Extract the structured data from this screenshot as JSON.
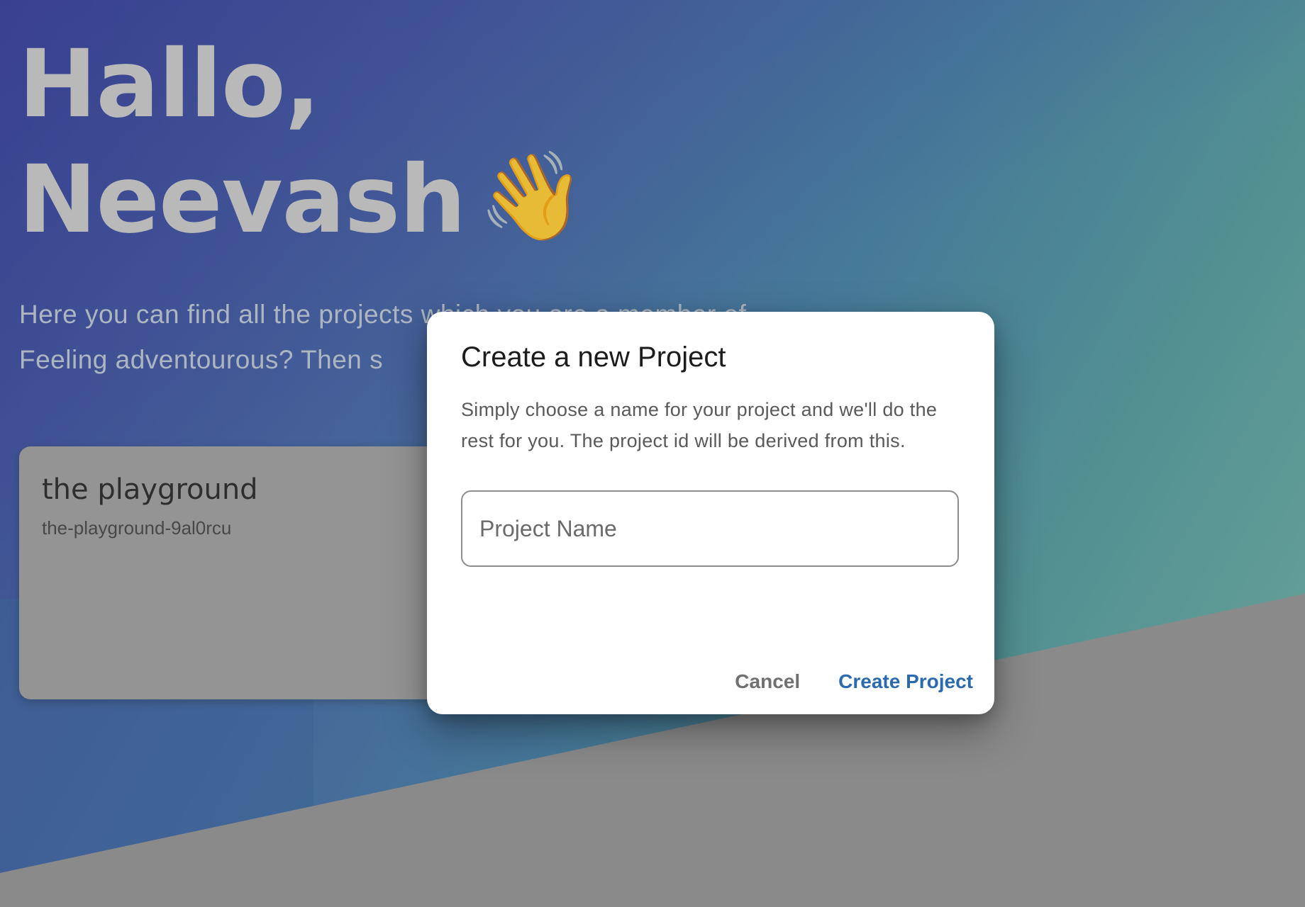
{
  "greeting": {
    "line1": "Hallo,",
    "line2": "Neevash",
    "emoji": "👋"
  },
  "intro": {
    "line1": "Here you can find all the projects which you are a member of.",
    "line2": "Feeling adventourous? Then s"
  },
  "projects": [
    {
      "name": "the playground",
      "id": "the-playground-9al0rcu"
    }
  ],
  "dialog": {
    "title": "Create a new Project",
    "description": "Simply choose a name for your project and we'll do the rest for you. The project id will be derived from this.",
    "field": {
      "placeholder": "Project Name",
      "value": ""
    },
    "cancel_label": "Cancel",
    "create_label": "Create Project"
  },
  "colors": {
    "accent": "#2a6aad",
    "dialog_bg": "#ffffff"
  }
}
